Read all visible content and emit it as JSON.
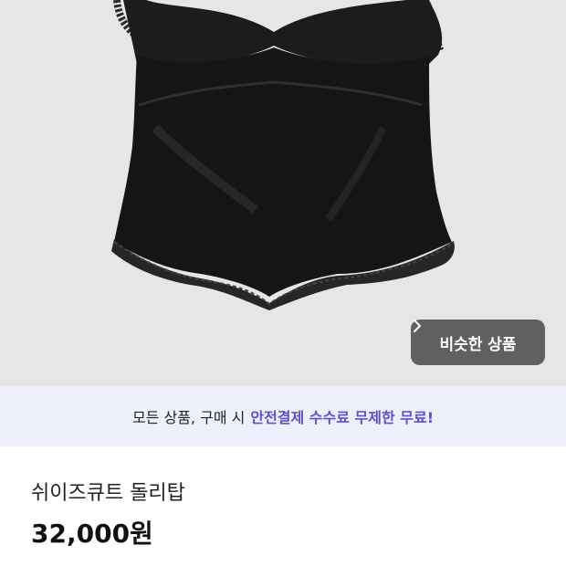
{
  "photo": {
    "subject": "black satin lace camisole"
  },
  "similar_button": {
    "label": "비슷한 상품",
    "icon": "chevron-right-icon"
  },
  "banner": {
    "prefix": "모든 상품, 구매 시",
    "highlight": "안전결제 수수료 무제한 무료!"
  },
  "product": {
    "title": "쉬이즈큐트 돌리탑",
    "price": "32,000원"
  },
  "colors": {
    "accent": "#5b4fd6",
    "banner_bg": "#eef0fc",
    "photo_bg": "#e6e6e6",
    "button_bg": "#555555"
  }
}
